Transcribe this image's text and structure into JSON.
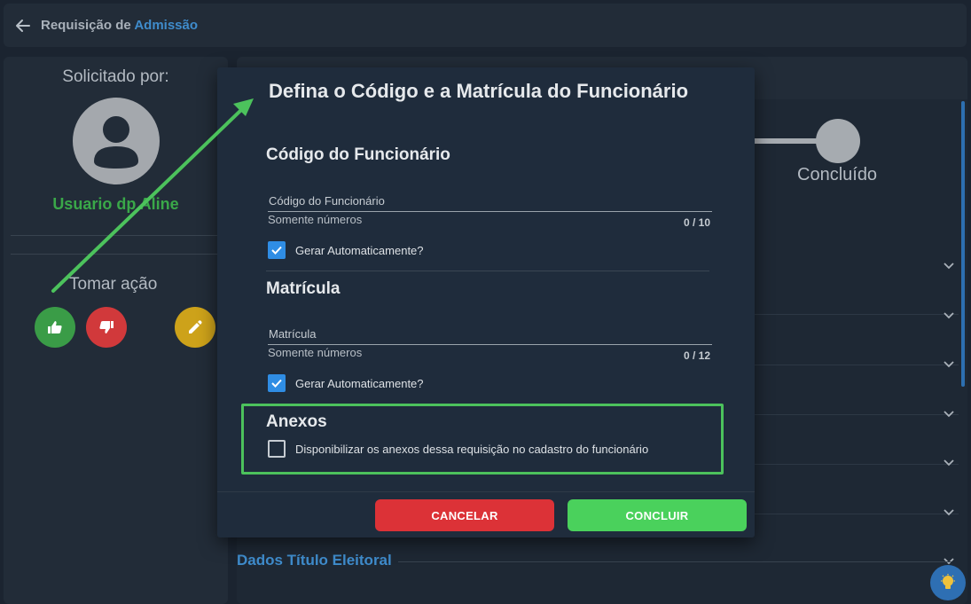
{
  "header": {
    "title_prefix": "Requisição de",
    "title_accent": "Admissão",
    "back_icon": "arrow-left-icon"
  },
  "sidebar": {
    "requested_by_label": "Solicitado por:",
    "user_name": "Usuario dp Aline",
    "take_action_label": "Tomar ação",
    "actions": [
      {
        "icon": "thumbs-up-icon",
        "color": "#3a9c47"
      },
      {
        "icon": "thumbs-down-icon",
        "color": "#d1393b"
      },
      {
        "icon": "pencil-icon",
        "color": "#cda21a"
      }
    ]
  },
  "main": {
    "step_label": "Concluído",
    "bottom_section_title": "Dados Título Eleitoral"
  },
  "modal": {
    "title": "Defina o Código e a Matrícula do Funcionário",
    "employee_code": {
      "section_title": "Código do Funcionário",
      "label": "Código do Funcionário",
      "value": "",
      "hint": "Somente números",
      "counter": "0 / 10",
      "auto_label": "Gerar Automaticamente?",
      "auto_checked": true
    },
    "registration": {
      "section_title": "Matrícula",
      "label": "Matrícula",
      "value": "",
      "hint": "Somente números",
      "counter": "0 / 12",
      "auto_label": "Gerar Automaticamente?",
      "auto_checked": true
    },
    "attachments": {
      "section_title": "Anexos",
      "option_label": "Disponibilizar os anexos dessa requisição no cadastro do funcionário",
      "option_checked": false
    },
    "cancel_label": "CANCELAR",
    "confirm_label": "CONCLUIR"
  },
  "colors": {
    "accent_blue": "#3f8ccc",
    "annotation_green": "#4cc25c",
    "cancel_red": "#dc3237",
    "confirm_green": "#4ad15c"
  }
}
